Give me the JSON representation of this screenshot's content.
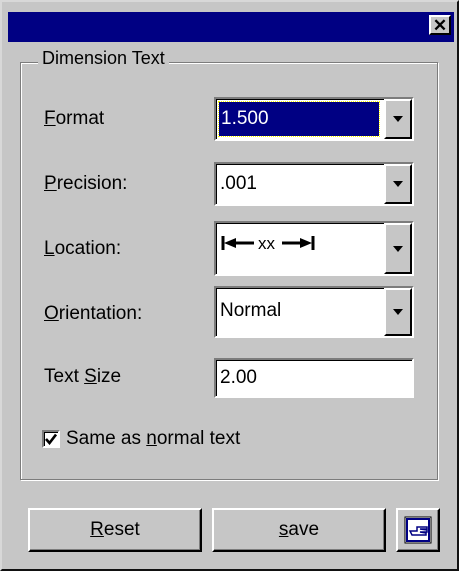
{
  "window": {
    "title": "",
    "close_glyph": "✕"
  },
  "group": {
    "title": "Dimension Text"
  },
  "fields": {
    "format": {
      "label_key": "F",
      "label_rest": "ormat",
      "value": "1.500"
    },
    "precision": {
      "label_key": "P",
      "label_rest": "recision:",
      "value": ".001"
    },
    "location": {
      "label_key": "L",
      "label_rest": "ocation:",
      "value": "|←xx→|"
    },
    "orientation": {
      "label_key": "O",
      "label_rest": "rientation:",
      "value": "Normal"
    },
    "text_size": {
      "label_pre": "Text ",
      "label_key": "S",
      "label_rest": "ize",
      "value": "2.00"
    }
  },
  "checkbox": {
    "label_pre": "Same as ",
    "label_key": "n",
    "label_rest": "ormal text",
    "checked": true
  },
  "buttons": {
    "reset": {
      "key": "R",
      "rest": "eset"
    },
    "save": {
      "key": "s",
      "rest": "ave"
    },
    "pick_icon": "pointing-hand-icon"
  },
  "colors": {
    "face": "#c6c6c6",
    "titlebar": "#000083",
    "selection": "#000083"
  }
}
